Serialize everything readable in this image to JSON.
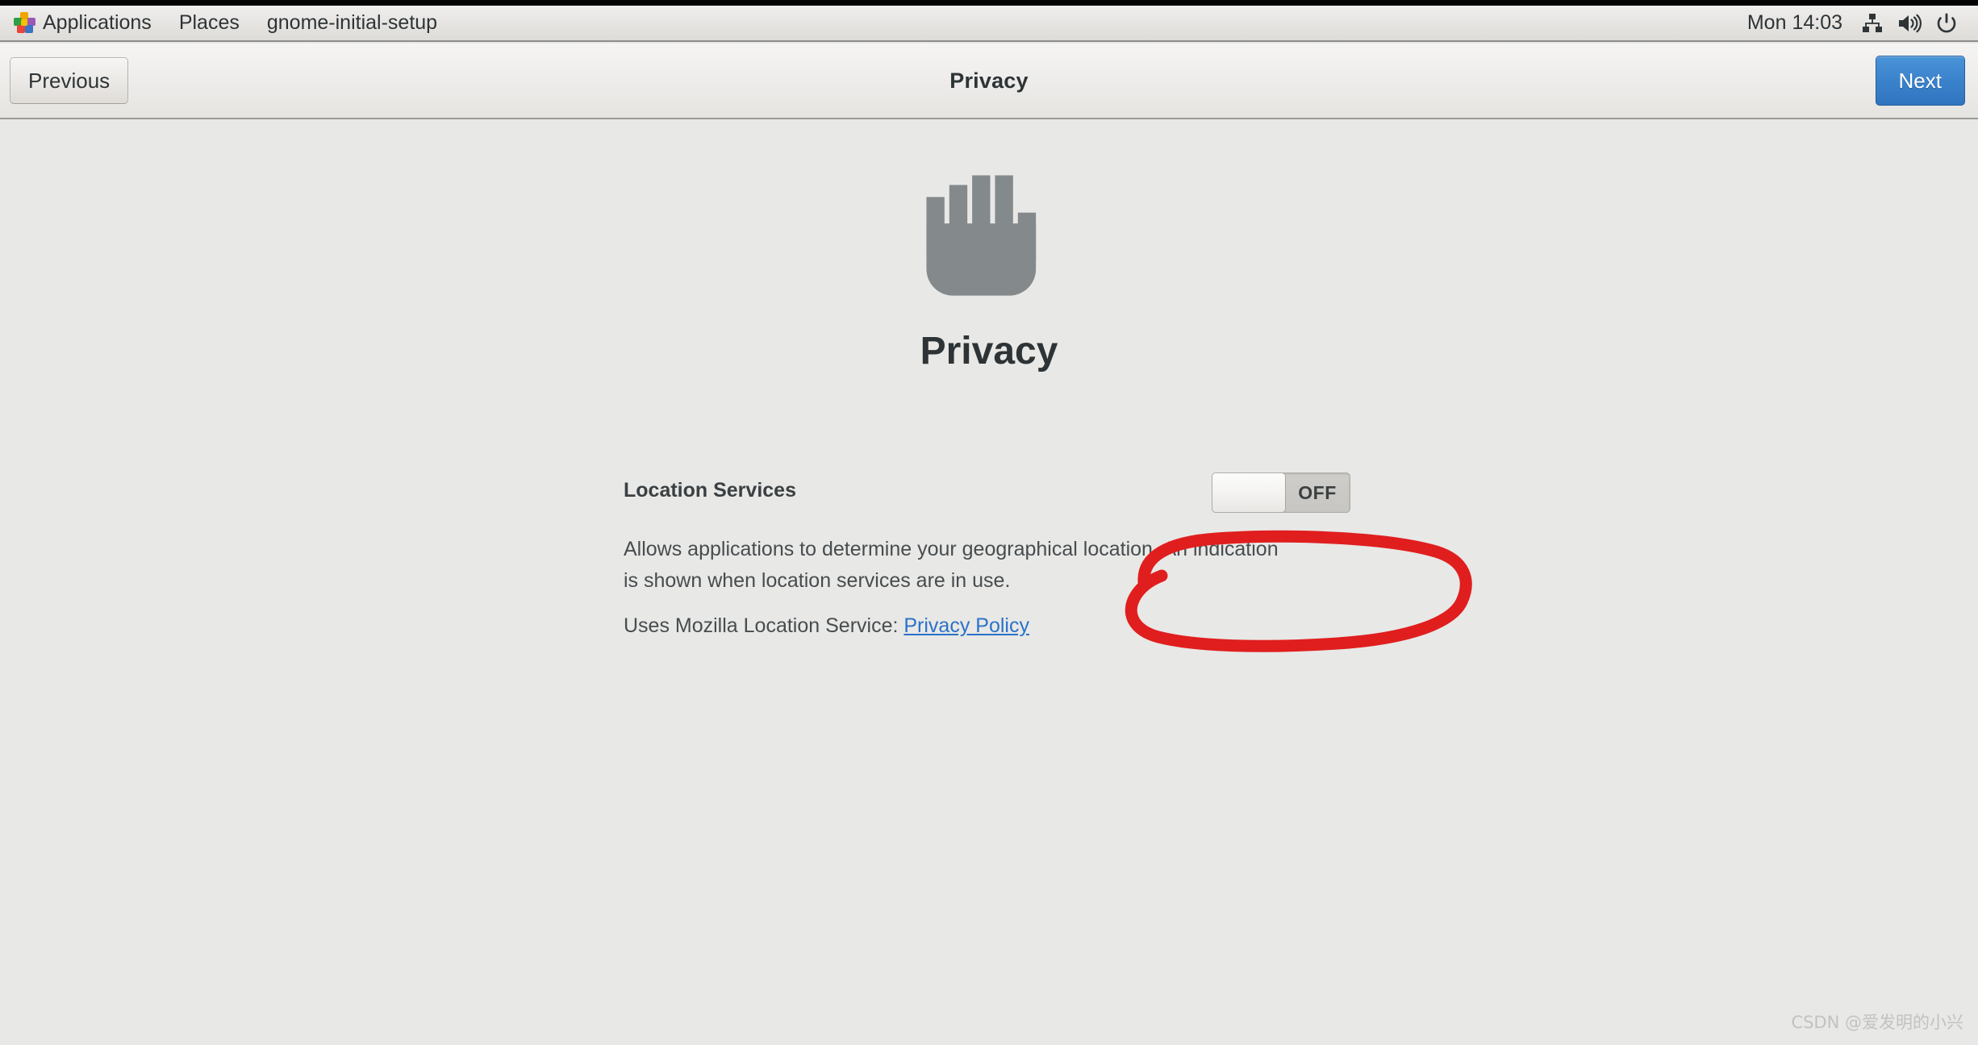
{
  "panel": {
    "apps_icon": "applications-grid-icon",
    "items": [
      {
        "label": "Applications"
      },
      {
        "label": "Places"
      },
      {
        "label": "gnome-initial-setup"
      }
    ],
    "clock": "Mon 14:03",
    "tray": [
      {
        "icon": "network-wired-icon"
      },
      {
        "icon": "volume-speaker-icon"
      },
      {
        "icon": "power-icon"
      }
    ]
  },
  "headerbar": {
    "previous_label": "Previous",
    "title": "Privacy",
    "next_label": "Next"
  },
  "content": {
    "hero_icon": "privacy-hand-icon",
    "heading": "Privacy",
    "setting": {
      "label": "Location Services",
      "switch_state": "OFF",
      "switch_on": false,
      "description": "Allows applications to determine your geographical location. An indication is shown when location services are in use.",
      "link_prefix": "Uses Mozilla Location Service:",
      "link_label": "Privacy Policy"
    }
  },
  "annotation": {
    "shape": "hand-drawn-oval",
    "color": "#e01e1e",
    "target": "location-services-switch"
  },
  "watermark": "CSDN @爱发明的小兴",
  "colors": {
    "panel_bg": "#e8e6e3",
    "content_bg": "#e8e8e6",
    "accent_blue": "#3b82cc",
    "link_blue": "#2a72c8",
    "text": "#2e3436",
    "icon_gray": "#848a8c",
    "annotation_red": "#e01e1e"
  }
}
